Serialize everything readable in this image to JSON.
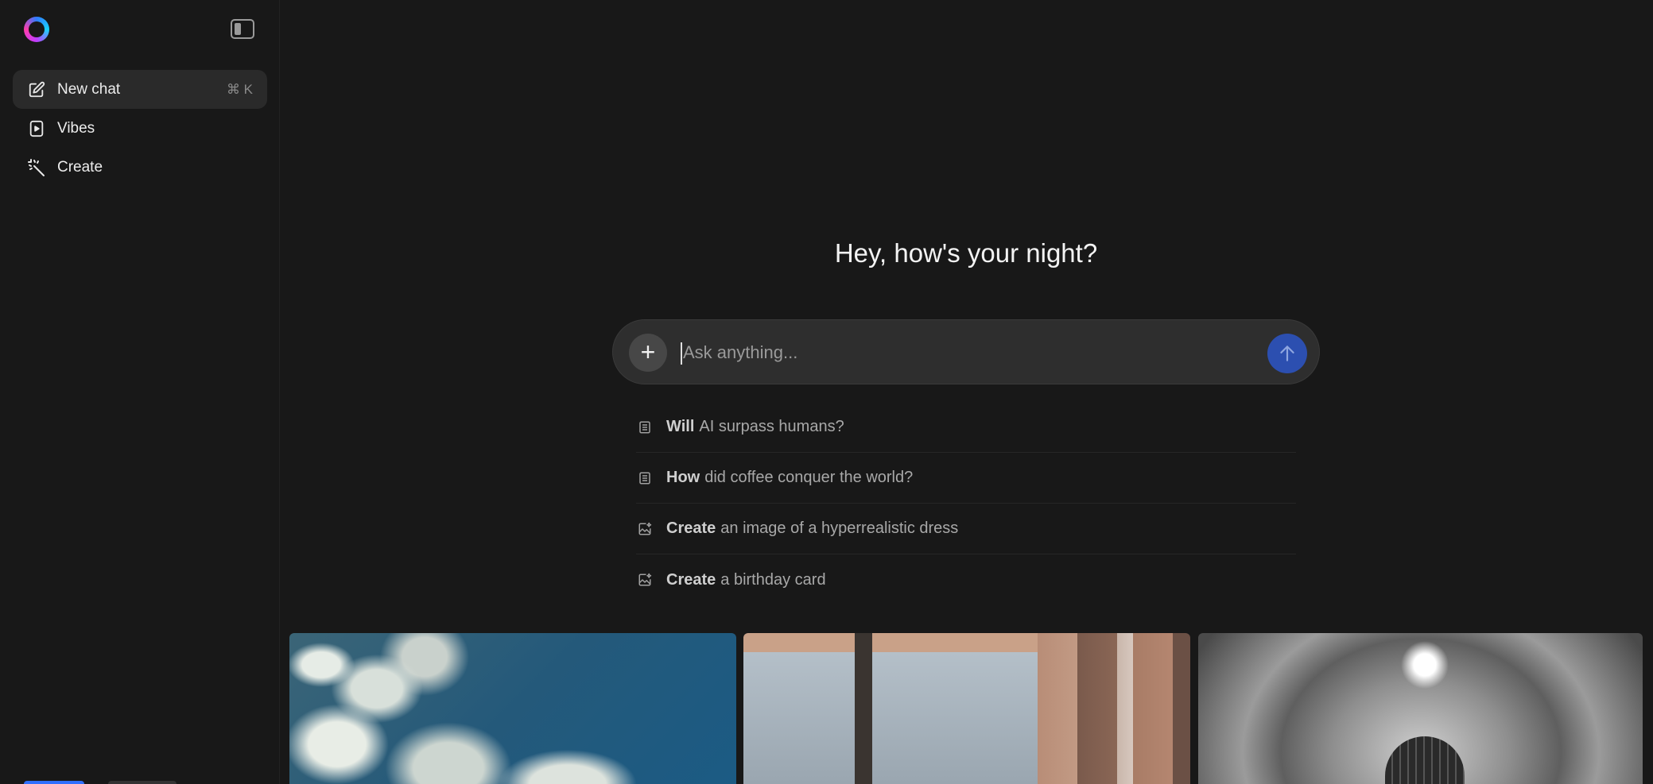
{
  "sidebar": {
    "logo": "meta-ai-ring-logo",
    "toggle_icon": "sidebar-toggle-icon",
    "items": [
      {
        "label": "New chat",
        "shortcut": "⌘ K",
        "icon": "edit-icon",
        "active": true
      },
      {
        "label": "Vibes",
        "icon": "video-play-icon",
        "active": false
      },
      {
        "label": "Create",
        "icon": "magic-wand-icon",
        "active": false
      }
    ]
  },
  "main": {
    "greeting": "Hey, how's your night?",
    "composer": {
      "placeholder": "Ask anything...",
      "add_icon": "plus-icon",
      "send_icon": "arrow-up-icon"
    },
    "suggestions": [
      {
        "lead": "Will",
        "rest": "AI surpass humans?",
        "icon": "document-icon"
      },
      {
        "lead": "How",
        "rest": "did coffee conquer the world?",
        "icon": "document-icon"
      },
      {
        "lead": "Create",
        "rest": "an image of a hyperrealistic dress",
        "icon": "image-sparkle-icon"
      },
      {
        "lead": "Create",
        "rest": "a birthday card",
        "icon": "image-sparkle-icon"
      }
    ]
  },
  "gallery": {
    "cards": [
      {
        "subject": "clouds-over-blue-sky"
      },
      {
        "subject": "wooden-building-forest"
      },
      {
        "subject": "braided-hair-portrait"
      }
    ]
  },
  "colors": {
    "background": "#181818",
    "active_item": "#2a2a2a",
    "composer": "#2e2e2e",
    "send_button": "#2c4fb0",
    "text_primary": "#f2f2f2",
    "text_muted": "#a8a8a8"
  }
}
